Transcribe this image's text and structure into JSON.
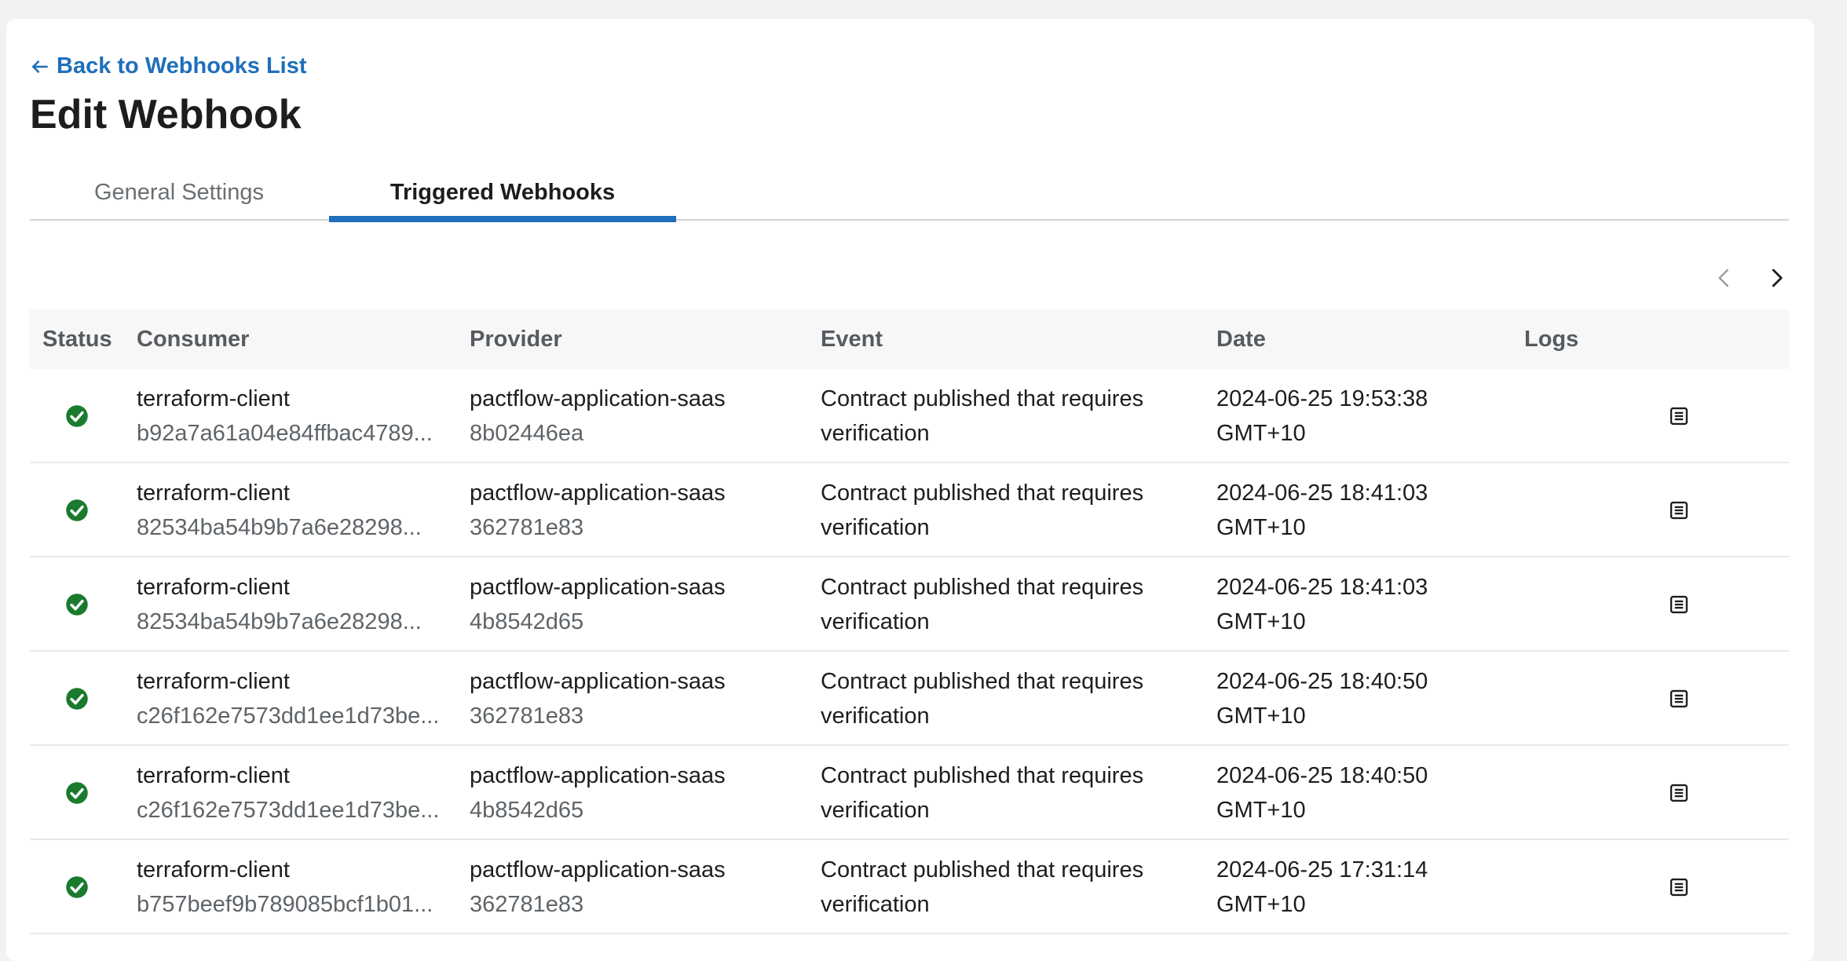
{
  "nav": {
    "back_label": "Back to Webhooks List"
  },
  "page": {
    "title": "Edit Webhook"
  },
  "tabs": [
    {
      "label": "General Settings",
      "active": false
    },
    {
      "label": "Triggered Webhooks",
      "active": true
    }
  ],
  "table": {
    "headers": {
      "status": "Status",
      "consumer": "Consumer",
      "provider": "Provider",
      "event": "Event",
      "date": "Date",
      "logs": "Logs"
    },
    "rows": [
      {
        "status": "success",
        "consumer_name": "terraform-client",
        "consumer_version": "b92a7a61a04e84ffbac4789...",
        "provider_name": "pactflow-application-saas",
        "provider_version": "8b02446ea",
        "event_line1": "Contract published that requires",
        "event_line2": "verification",
        "date_line1": "2024-06-25 19:53:38",
        "date_line2": "GMT+10"
      },
      {
        "status": "success",
        "consumer_name": "terraform-client",
        "consumer_version": "82534ba54b9b7a6e28298...",
        "provider_name": "pactflow-application-saas",
        "provider_version": "362781e83",
        "event_line1": "Contract published that requires",
        "event_line2": "verification",
        "date_line1": "2024-06-25 18:41:03",
        "date_line2": "GMT+10"
      },
      {
        "status": "success",
        "consumer_name": "terraform-client",
        "consumer_version": "82534ba54b9b7a6e28298...",
        "provider_name": "pactflow-application-saas",
        "provider_version": "4b8542d65",
        "event_line1": "Contract published that requires",
        "event_line2": "verification",
        "date_line1": "2024-06-25 18:41:03",
        "date_line2": "GMT+10"
      },
      {
        "status": "success",
        "consumer_name": "terraform-client",
        "consumer_version": "c26f162e7573dd1ee1d73be...",
        "provider_name": "pactflow-application-saas",
        "provider_version": "362781e83",
        "event_line1": "Contract published that requires",
        "event_line2": "verification",
        "date_line1": "2024-06-25 18:40:50",
        "date_line2": "GMT+10"
      },
      {
        "status": "success",
        "consumer_name": "terraform-client",
        "consumer_version": "c26f162e7573dd1ee1d73be...",
        "provider_name": "pactflow-application-saas",
        "provider_version": "4b8542d65",
        "event_line1": "Contract published that requires",
        "event_line2": "verification",
        "date_line1": "2024-06-25 18:40:50",
        "date_line2": "GMT+10"
      },
      {
        "status": "success",
        "consumer_name": "terraform-client",
        "consumer_version": "b757beef9b789085bcf1b01...",
        "provider_name": "pactflow-application-saas",
        "provider_version": "362781e83",
        "event_line1": "Contract published that requires",
        "event_line2": "verification",
        "date_line1": "2024-06-25 17:31:14",
        "date_line2": "GMT+10"
      }
    ]
  },
  "icons": {
    "back": "arrow-left-icon",
    "status_success": "check-circle-icon",
    "logs": "document-list-icon",
    "prev": "chevron-left-icon",
    "next": "chevron-right-icon"
  },
  "colors": {
    "accent": "#1f6fba",
    "success": "#1a7a2e",
    "prev_disabled": "#9aa0a5"
  }
}
